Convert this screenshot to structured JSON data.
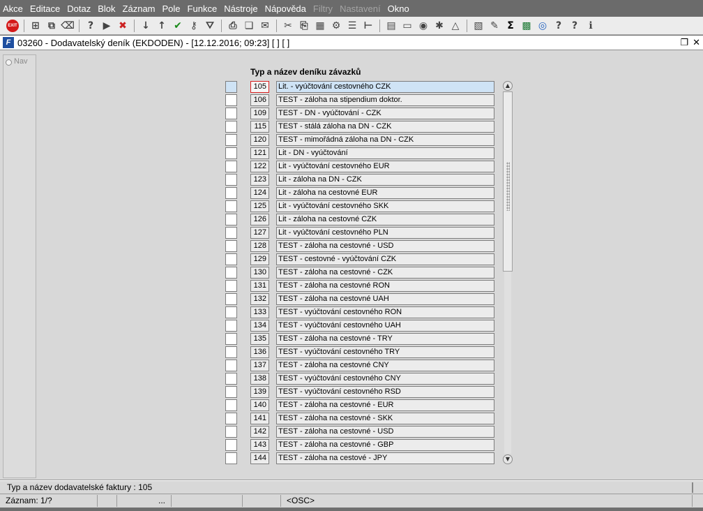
{
  "menubar": {
    "items": [
      {
        "label": "Akce",
        "enabled": true
      },
      {
        "label": "Editace",
        "enabled": true
      },
      {
        "label": "Dotaz",
        "enabled": true
      },
      {
        "label": "Blok",
        "enabled": true
      },
      {
        "label": "Záznam",
        "enabled": true
      },
      {
        "label": "Pole",
        "enabled": true
      },
      {
        "label": "Funkce",
        "enabled": true
      },
      {
        "label": "Nástroje",
        "enabled": true
      },
      {
        "label": "Nápověda",
        "enabled": true
      },
      {
        "label": "Filtry",
        "enabled": false
      },
      {
        "label": "Nastavení",
        "enabled": false
      },
      {
        "label": "Okno",
        "enabled": true
      }
    ]
  },
  "toolbar": {
    "exit_label": "EXIT",
    "icons": [
      "exit-icon",
      "sep",
      "insert-record-icon",
      "duplicate-record-icon",
      "clear-record-icon",
      "sep",
      "query-enter-icon",
      "query-execute-icon",
      "query-cancel-icon",
      "sep",
      "sort-ascending-icon",
      "sort-descending-icon",
      "commit-checkmark-icon",
      "key-icon",
      "filter-icon",
      "sep",
      "print-icon",
      "copy-icon",
      "send-mail-icon",
      "sep",
      "cut-icon",
      "paste-icon",
      "block-icon",
      "tools-icon",
      "list-icon",
      "tree-icon",
      "sep",
      "clipboard-icon",
      "document-icon",
      "globe-icon",
      "settings-icon",
      "warning-icon",
      "sep",
      "chart-icon",
      "edit-icon",
      "sum-icon",
      "excel-icon",
      "web-icon",
      "help-search-icon",
      "help-icon",
      "info-icon"
    ]
  },
  "window": {
    "title": "03260 - Dodavatelský deník (EKDODEN) - [12.12.2016; 09:23]  [ ]  [ ]",
    "restore_glyph": "❐",
    "close_glyph": "✕"
  },
  "nav": {
    "label": "Nav"
  },
  "list": {
    "header": "Typ a název deníku závazků",
    "rows": [
      {
        "code": "105",
        "name": "Lit. - vyúčtování cestovného CZK"
      },
      {
        "code": "106",
        "name": "TEST - záloha na stipendium doktor."
      },
      {
        "code": "109",
        "name": "TEST - DN - vyúčtování - CZK"
      },
      {
        "code": "115",
        "name": "TEST - stálá záloha na DN - CZK"
      },
      {
        "code": "120",
        "name": "TEST - mimořádná záloha na DN - CZK"
      },
      {
        "code": "121",
        "name": "Lit - DN - vyúčtování"
      },
      {
        "code": "122",
        "name": "Lit - vyúčtování cestovného EUR"
      },
      {
        "code": "123",
        "name": "Lit - záloha na DN - CZK"
      },
      {
        "code": "124",
        "name": "Lit - záloha na cestovné EUR"
      },
      {
        "code": "125",
        "name": "Lit - vyúčtování cestovného SKK"
      },
      {
        "code": "126",
        "name": "Lit - záloha na cestovné CZK"
      },
      {
        "code": "127",
        "name": "Lit - vyúčtování cestovného PLN"
      },
      {
        "code": "128",
        "name": "TEST - záloha na cestovné - USD"
      },
      {
        "code": "129",
        "name": "TEST - cestovné - vyúčtování CZK"
      },
      {
        "code": "130",
        "name": "TEST - záloha na cestovné - CZK"
      },
      {
        "code": "131",
        "name": "TEST - záloha na cestovné RON"
      },
      {
        "code": "132",
        "name": "TEST - záloha na cestovné UAH"
      },
      {
        "code": "133",
        "name": "TEST - vyúčtování cestovného RON"
      },
      {
        "code": "134",
        "name": "TEST - vyúčtování cestovného UAH"
      },
      {
        "code": "135",
        "name": "TEST - záloha na cestovné - TRY"
      },
      {
        "code": "136",
        "name": "TEST - vyúčtování cestovného TRY"
      },
      {
        "code": "137",
        "name": "TEST - záloha na cestovné CNY"
      },
      {
        "code": "138",
        "name": "TEST - vyúčtování cestovného CNY"
      },
      {
        "code": "139",
        "name": "TEST - vyúčtování cestovného RSD"
      },
      {
        "code": "140",
        "name": "TEST - záloha na cestovné - EUR"
      },
      {
        "code": "141",
        "name": "TEST - záloha na cestovné - SKK"
      },
      {
        "code": "142",
        "name": "TEST - záloha na cestovné - USD"
      },
      {
        "code": "143",
        "name": "TEST - záloha na cestovné - GBP"
      },
      {
        "code": "144",
        "name": "TEST - záloha na cestové - JPY"
      }
    ]
  },
  "scroll": {
    "up_glyph": "▲",
    "down_glyph": "▼"
  },
  "hint": {
    "text": "Typ a název dodavatelské faktury : 105"
  },
  "status": {
    "record": "Záznam: 1/?",
    "ellipsis": "...",
    "mode": "<OSC>"
  }
}
